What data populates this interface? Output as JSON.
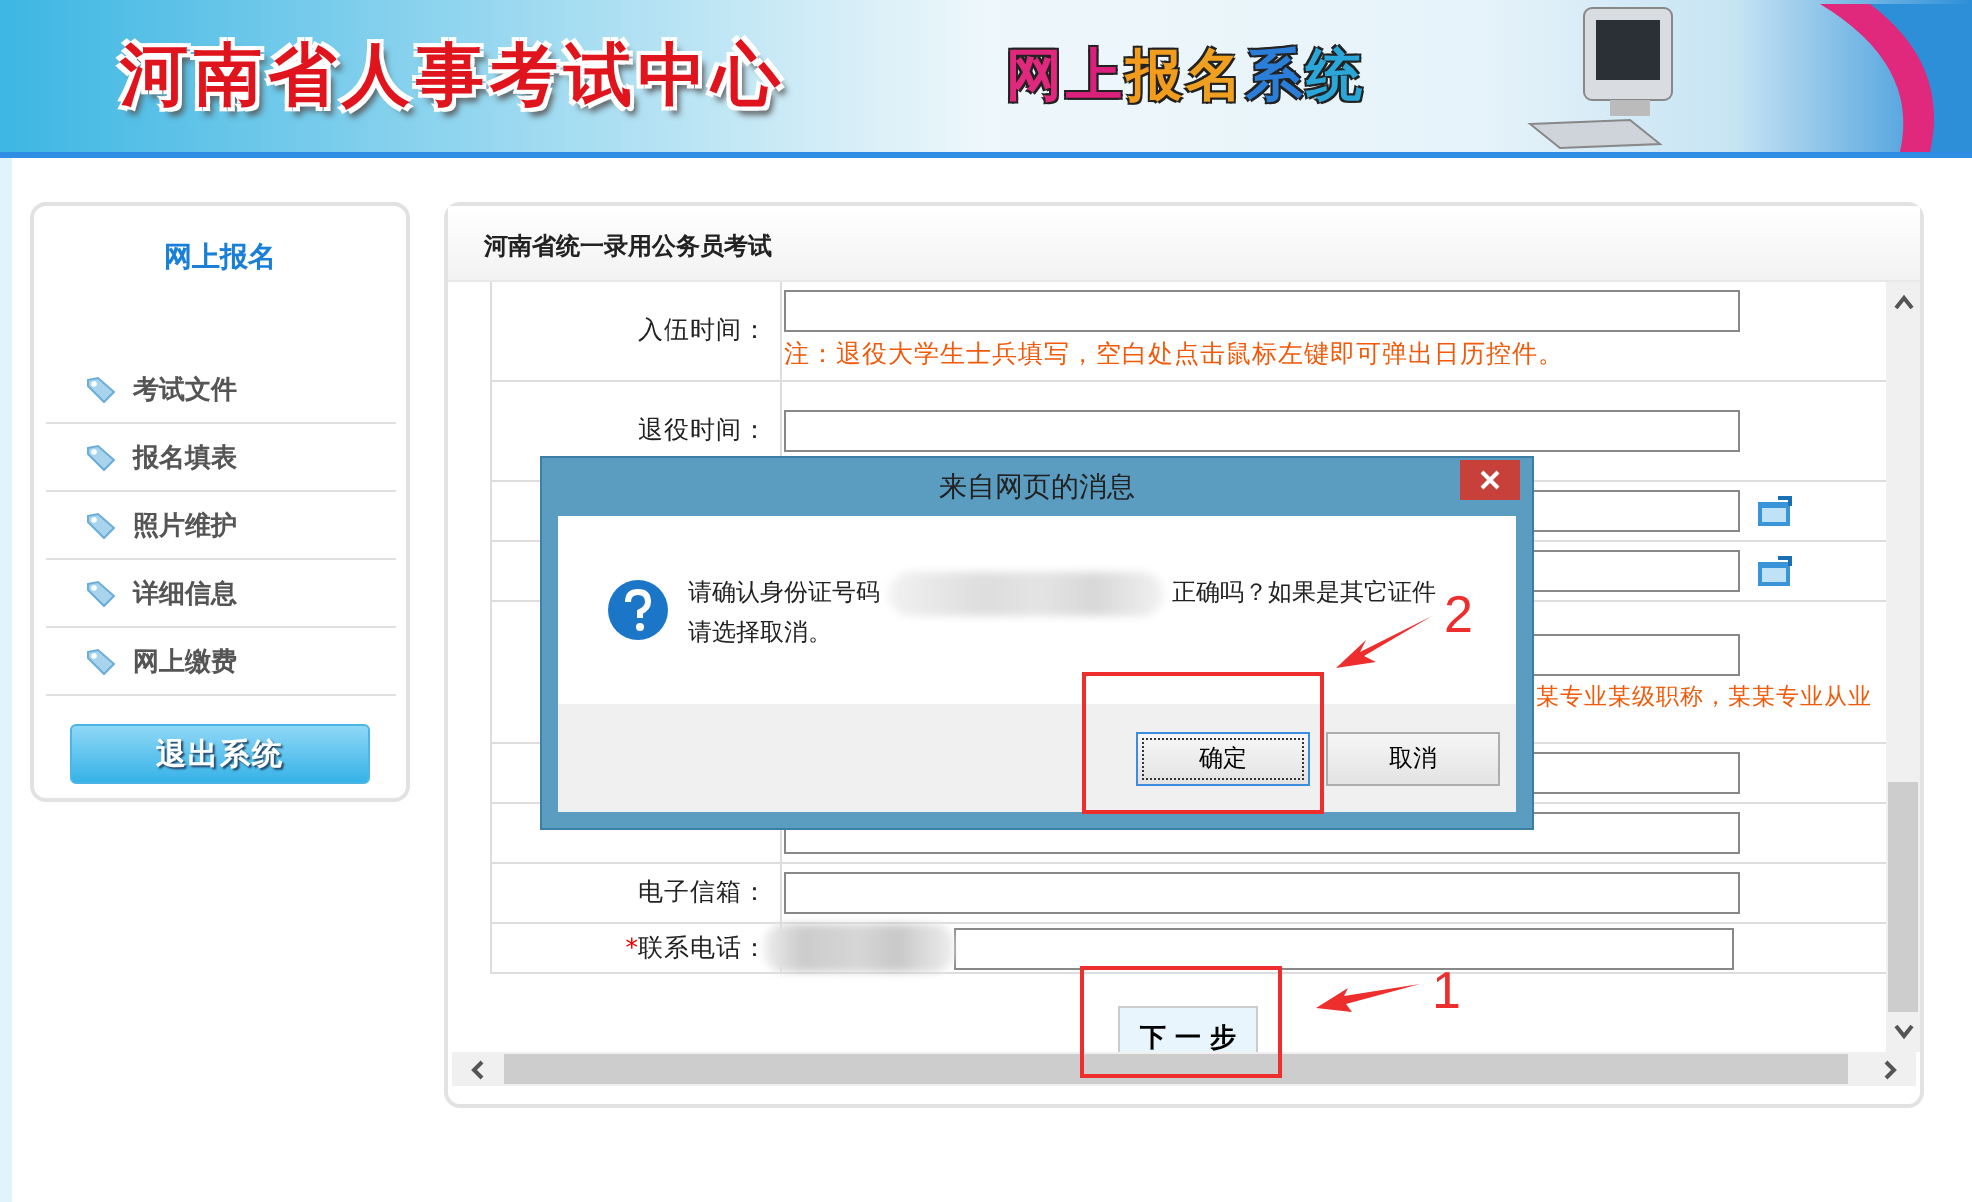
{
  "header": {
    "title": "河南省人事考试中心",
    "system_name": "网上报名系统"
  },
  "sidebar": {
    "title": "网上报名",
    "items": [
      {
        "label": "考试文件"
      },
      {
        "label": "报名填表"
      },
      {
        "label": "照片维护"
      },
      {
        "label": "详细信息"
      },
      {
        "label": "网上缴费"
      }
    ],
    "logout_button": "退出系统"
  },
  "main": {
    "title": "河南省统一录用公务员考试",
    "rows": [
      {
        "kind": "field",
        "label": "入伍时间：",
        "note": "注：退役大学生士兵填写，空白处点击鼠标左键即可弹出日历控件。"
      },
      {
        "kind": "tall",
        "label": "退役时间："
      },
      {
        "kind": "picker"
      },
      {
        "kind": "picker"
      },
      {
        "kind": "covered",
        "note": "某专业某级职称，某某专业从业"
      },
      {
        "kind": "field"
      },
      {
        "kind": "field"
      },
      {
        "kind": "field",
        "label": "电子信箱："
      },
      {
        "kind": "redacted",
        "label": "联系电话：",
        "required_mark": "*"
      }
    ],
    "next_button": "下 一 步"
  },
  "dialog": {
    "title": "来自网页的消息",
    "message_before": "请确认身份证号码",
    "message_after": "正确吗？如果是其它证件",
    "message_line2": "请选择取消。",
    "buttons": [
      {
        "label": "确定",
        "selected": true
      },
      {
        "label": "取消",
        "selected": false
      }
    ]
  },
  "annotations": [
    {
      "number": "2"
    },
    {
      "number": "1"
    }
  ]
}
